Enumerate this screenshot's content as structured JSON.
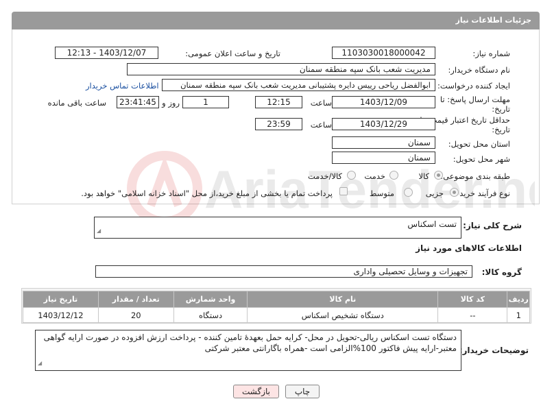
{
  "header": {
    "title": "جزئیات اطلاعات نیاز"
  },
  "fields": {
    "need_number_label": "شماره نیاز:",
    "need_number": "1103030018000042",
    "announce_label": "تاریخ و ساعت اعلان عمومی:",
    "announce_value": "1403/12/07 - 12:13",
    "buyer_org_label": "نام دستگاه خریدار:",
    "buyer_org": "مدیریت شعب بانک سپه منطقه سمنان",
    "creator_label": "ایجاد کننده درخواست:",
    "creator": "ابوالفضل ریاحی رییس دایره پشتیبانی مدیریت شعب بانک سپه منطقه سمنان",
    "contact_link": "اطلاعات تماس خریدار",
    "deadline_label": "مهلت ارسال پاسخ: تا",
    "deadline_label2": "تاریخ:",
    "deadline_date": "1403/12/09",
    "time_label": "ساعت",
    "deadline_time": "12:15",
    "days_value": "1",
    "days_label": "روز و",
    "remaining_time": "23:41:45",
    "remaining_label": "ساعت باقی مانده",
    "validity_label": "حداقل تاریخ اعتبار قیمت: تا",
    "validity_label2": "تاریخ:",
    "validity_date": "1403/12/29",
    "validity_time_label": "ساعت",
    "validity_time": "23:59",
    "province_label": "استان محل تحویل:",
    "province": "سمنان",
    "city_label": "شهر محل تحویل:",
    "city": "سمنان",
    "category_label": "طبقه بندی موضوعی:",
    "category_options": [
      "کالا",
      "خدمت",
      "کالا/خدمت"
    ],
    "process_label": "نوع فرآیند خرید :",
    "process_options": [
      "جزیی",
      "متوسط"
    ],
    "payment_note": "پرداخت تمام یا بخشی از مبلغ خرید،از محل \"اسناد خزانه اسلامی\" خواهد بود."
  },
  "description": {
    "label": "شرح کلی نیاز:",
    "value": "تست اسکناس"
  },
  "goods_section_title": "اطلاعات کالاهای مورد نیاز",
  "goods_group": {
    "label": "گروه کالا:",
    "value": "تجهیزات و وسایل تحصیلی واداری"
  },
  "table": {
    "headers": [
      "ردیف",
      "کد کالا",
      "نام کالا",
      "واحد شمارش",
      "تعداد / مقدار",
      "تاریخ نیاز"
    ],
    "rows": [
      [
        "1",
        "--",
        "دستگاه تشخیص اسکناس",
        "دستگاه",
        "20",
        "1403/12/12"
      ]
    ]
  },
  "buyer_notes": {
    "label": "توضیحات خریدار:",
    "value": "دستگاه تست اسکناس ریالی-تحویل در محل- کرایه حمل بعهدهٔ تامین کننده - پرداخت ارزش افزوده در صورت ارایه گواهی معتبر-ارایه پیش فاکتور 100%الزامی است -همراه باگارانتی معتبر شرکتی"
  },
  "buttons": {
    "print": "چاپ",
    "back": "بازگشت"
  },
  "watermark": {
    "text": "AriaTender.neT"
  },
  "colors": {
    "header_bg": "#9a9a9a",
    "link": "#1a4fa0",
    "back_button": "#fde4e4"
  }
}
